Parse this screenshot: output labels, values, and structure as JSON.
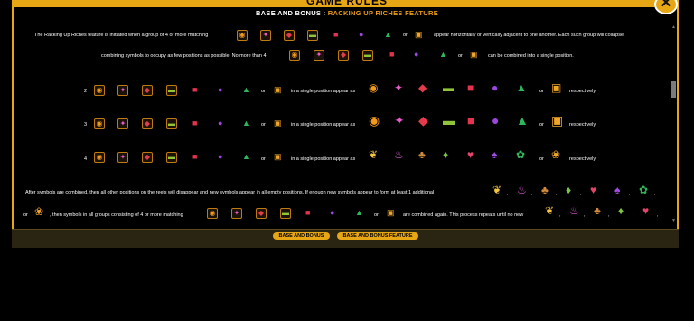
{
  "header": {
    "title": "GAME RULES",
    "close_label": "✕"
  },
  "section": {
    "prefix": "BASE AND BONUS : ",
    "highlight": "RACKING UP RICHES FEATURE"
  },
  "paragraph1": {
    "line1_start": "The Racking Up Riches feature is initiated when a group of 4 or more matching",
    "line1_end": "appear horizontally or vertically adjacent to one another. Each such group will collapse,",
    "line2_start": "combining symbols to occupy as few positions as possible. No more than 4",
    "line2_end": "can be combined into a single position."
  },
  "rows": [
    {
      "count": "2",
      "middle": "in a single position appear as",
      "end": ", respectively."
    },
    {
      "count": "3",
      "middle": "in a single position appear as",
      "end": ", respectively."
    },
    {
      "count": "4",
      "middle": "in a single position appear as",
      "end": ", respectively."
    }
  ],
  "paragraph2": {
    "line1": "After symbols are combined, then all other positions on the reels will disappear and new symbols appear in all empty positions. If enough new symbols appear to form at least 1 additional",
    "line2_start": ", then symbols in all groups consisting of 4 or more matching",
    "line2_end": "are combined again. This process repeats until no new"
  },
  "connectors": {
    "comma": ",",
    "or": "or",
    "or_lower": "or"
  },
  "tabs": [
    "BASE AND BONUS",
    "BASE AND BONUS FEATURE"
  ],
  "colors": {
    "accent": "#e7a613",
    "background": "#000000"
  }
}
